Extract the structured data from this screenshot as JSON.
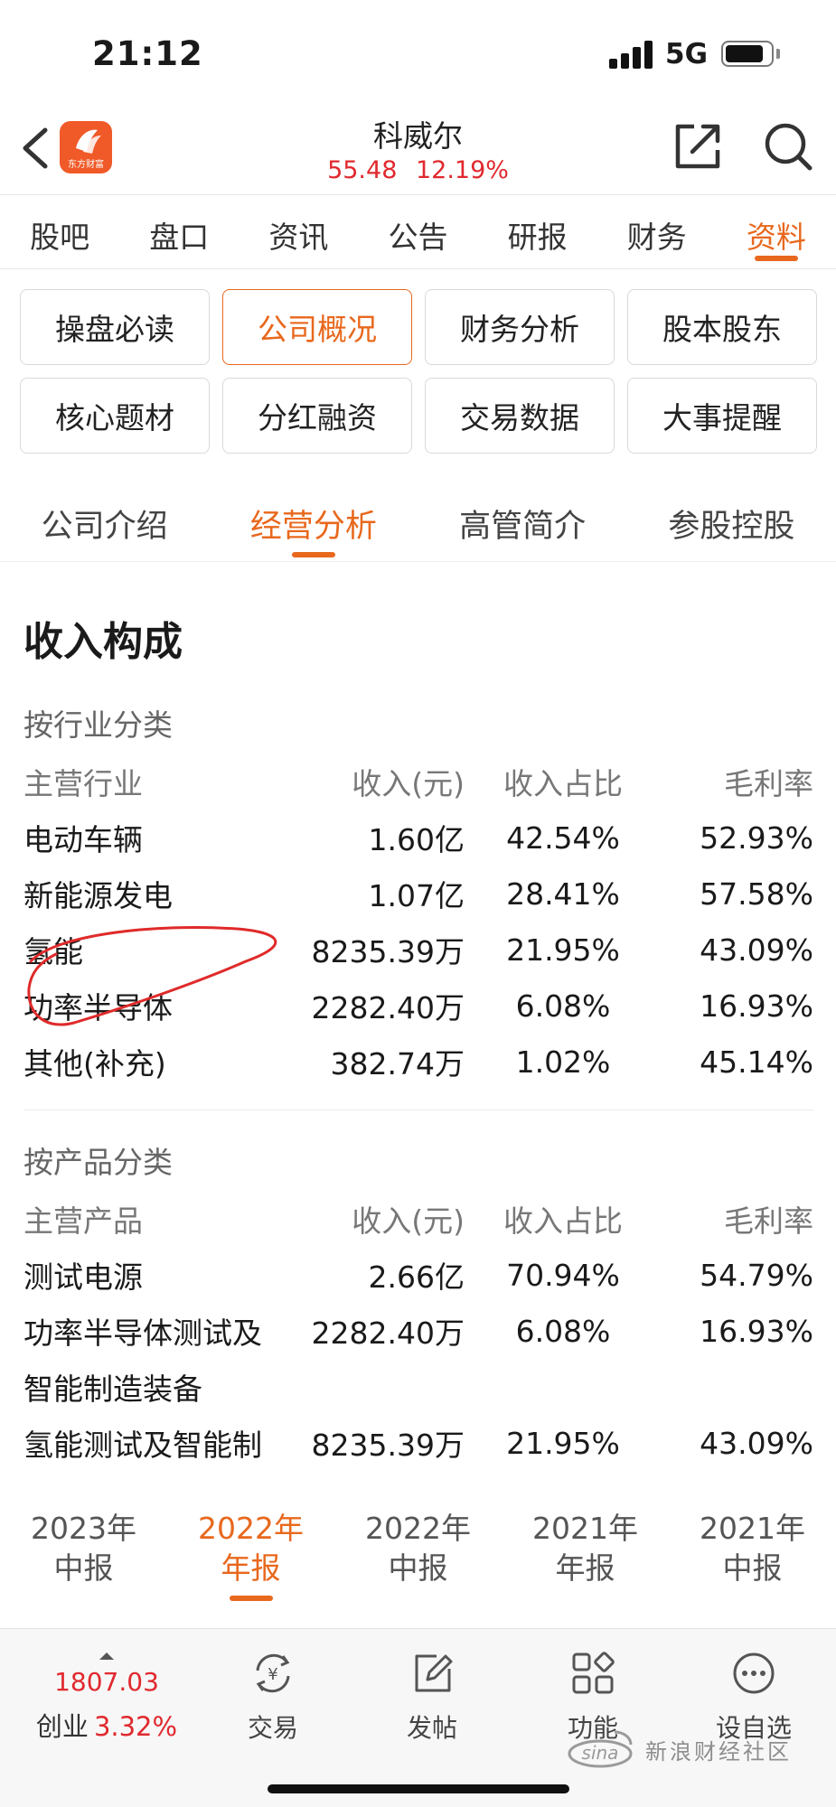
{
  "status_bar": {
    "time": "21:12",
    "network": "5G"
  },
  "header": {
    "stock_name": "科威尔",
    "price": "55.48",
    "change_pct": "12.19%",
    "logo_text": "东方财富"
  },
  "top_tabs": [
    {
      "label": "股吧"
    },
    {
      "label": "盘口"
    },
    {
      "label": "资讯"
    },
    {
      "label": "公告"
    },
    {
      "label": "研报"
    },
    {
      "label": "财务"
    },
    {
      "label": "资料"
    }
  ],
  "grid_buttons": [
    {
      "label": "操盘必读"
    },
    {
      "label": "公司概况"
    },
    {
      "label": "财务分析"
    },
    {
      "label": "股本股东"
    },
    {
      "label": "核心题材"
    },
    {
      "label": "分红融资"
    },
    {
      "label": "交易数据"
    },
    {
      "label": "大事提醒"
    }
  ],
  "sub_tabs": [
    {
      "label": "公司介绍"
    },
    {
      "label": "经营分析"
    },
    {
      "label": "高管简介"
    },
    {
      "label": "参股控股"
    }
  ],
  "section_title": "收入构成",
  "industry": {
    "label": "按行业分类",
    "columns": [
      "主营行业",
      "收入(元)",
      "收入占比",
      "毛利率"
    ],
    "rows": [
      [
        "电动车辆",
        "1.60亿",
        "42.54%",
        "52.93%"
      ],
      [
        "新能源发电",
        "1.07亿",
        "28.41%",
        "57.58%"
      ],
      [
        "氢能",
        "8235.39万",
        "21.95%",
        "43.09%"
      ],
      [
        "功率半导体",
        "2282.40万",
        "6.08%",
        "16.93%"
      ],
      [
        "其他(补充)",
        "382.74万",
        "1.02%",
        "45.14%"
      ]
    ]
  },
  "product": {
    "label": "按产品分类",
    "columns": [
      "主营产品",
      "收入(元)",
      "收入占比",
      "毛利率"
    ],
    "rows": [
      [
        "测试电源",
        "2.66亿",
        "70.94%",
        "54.79%"
      ],
      [
        "功率半导体测试及",
        "2282.40万",
        "6.08%",
        "16.93%"
      ],
      [
        "智能制造装备",
        "",
        "",
        ""
      ],
      [
        "氢能测试及智能制",
        "8235.39万",
        "21.95%",
        "43.09%"
      ]
    ]
  },
  "year_tabs": [
    {
      "year": "2023年",
      "period": "中报"
    },
    {
      "year": "2022年",
      "period": "年报"
    },
    {
      "year": "2022年",
      "period": "中报"
    },
    {
      "year": "2021年",
      "period": "年报"
    },
    {
      "year": "2021年",
      "period": "中报"
    }
  ],
  "bottom_bar": {
    "index_value": "1807.03",
    "index_name": "创业",
    "index_pct": "3.32%",
    "items": [
      {
        "label": "交易",
        "icon": "yen-exchange-icon"
      },
      {
        "label": "发帖",
        "icon": "edit-post-icon"
      },
      {
        "label": "功能",
        "icon": "grid-apps-icon"
      },
      {
        "label": "设自选",
        "icon": "more-dots-icon"
      }
    ]
  },
  "watermark": {
    "text": "新浪财经社区"
  },
  "colors": {
    "accent": "#e8681d",
    "up": "#e0292e",
    "annotation": "#e02a2a"
  }
}
